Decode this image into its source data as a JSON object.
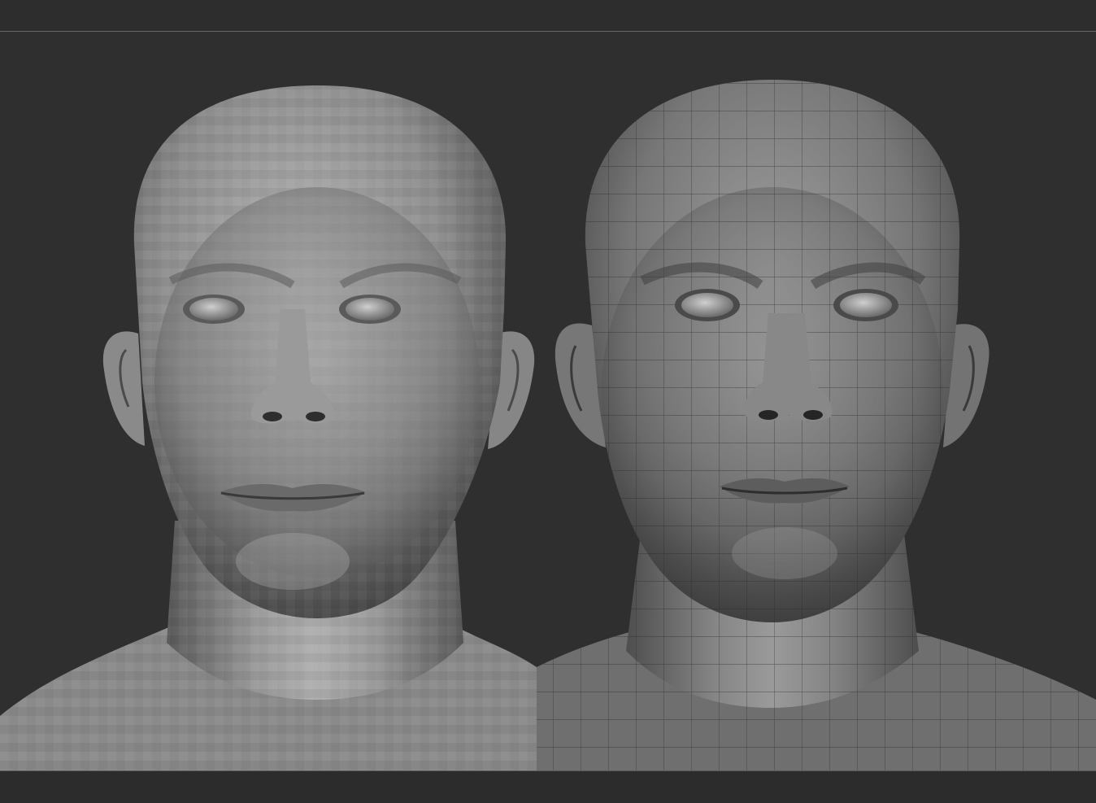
{
  "viewport": {
    "background_color": "#2f2f2f",
    "divider_color": "#6a6a6a"
  },
  "models": [
    {
      "name": "low-resolution-base-mesh-head",
      "material_color": "#8c8c8c",
      "shading": "faceted"
    },
    {
      "name": "high-resolution-sculpted-head-with-wireframe",
      "material_color": "#7a7a7a",
      "shading": "smooth-with-polygroup-wireframe"
    }
  ]
}
